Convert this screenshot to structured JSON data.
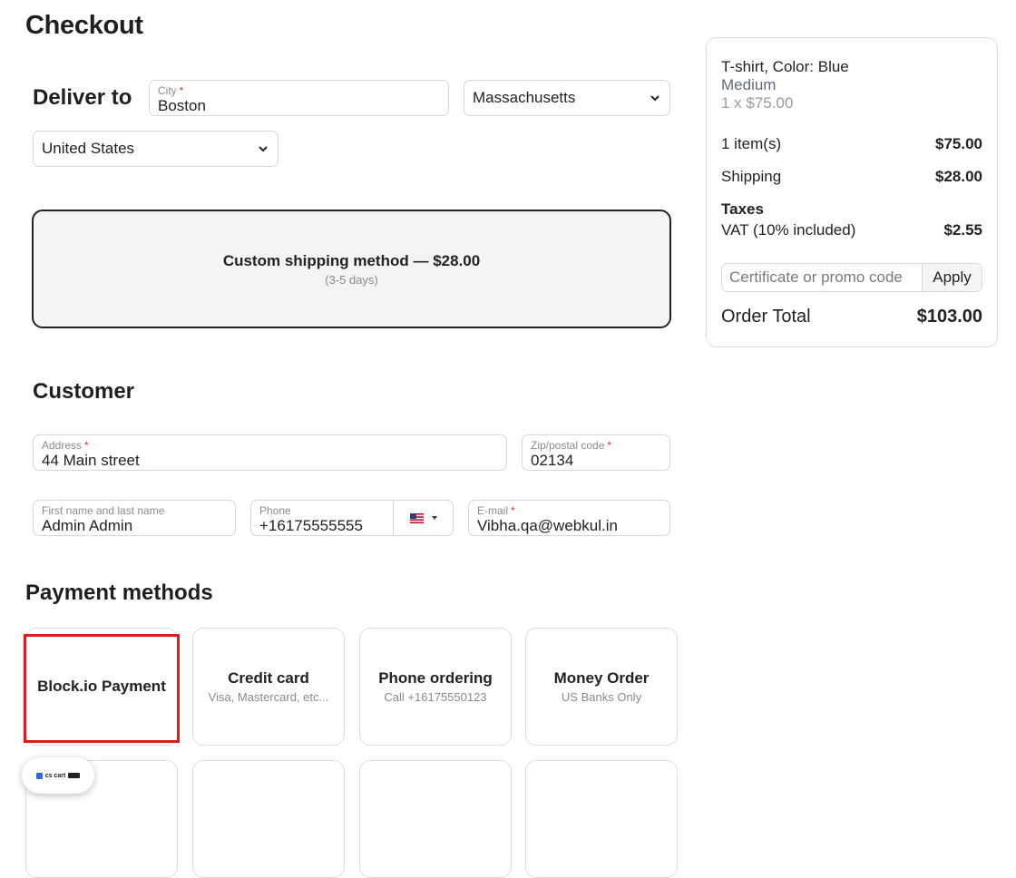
{
  "page": {
    "title": "Checkout"
  },
  "deliver": {
    "heading": "Deliver to",
    "city": {
      "label": "City",
      "required": "*",
      "value": "Boston"
    },
    "state": {
      "value": "Massachusetts"
    },
    "country": {
      "value": "United States"
    }
  },
  "shipping": {
    "title": "Custom shipping method — $28.00",
    "subtitle": "(3-5 days)"
  },
  "customer": {
    "heading": "Customer",
    "address": {
      "label": "Address",
      "required": "*",
      "value": "44 Main street"
    },
    "zip": {
      "label": "Zip/postal code",
      "required": "*",
      "value": "02134"
    },
    "name": {
      "label": "First name and last name",
      "value": "Admin Admin"
    },
    "phone": {
      "label": "Phone",
      "value": "+16175555555"
    },
    "email": {
      "label": "E-mail",
      "required": "*",
      "value": "Vibha.qa@webkul.in"
    }
  },
  "payment": {
    "heading": "Payment methods",
    "methods": [
      {
        "title": "Block.io Payment",
        "subtitle": ""
      },
      {
        "title": "Credit card",
        "subtitle": "Visa, Mastercard, etc..."
      },
      {
        "title": "Phone ordering",
        "subtitle": "Call +16175550123"
      },
      {
        "title": "Money Order",
        "subtitle": "US Banks Only"
      }
    ]
  },
  "summary": {
    "product": {
      "name": "T-shirt, Color: Blue",
      "variant": "Medium",
      "qty_price": "1 x $75.00"
    },
    "items_label": "1 item(s)",
    "items_value": "$75.00",
    "shipping_label": "Shipping",
    "shipping_value": "$28.00",
    "taxes_label": "Taxes",
    "vat_label": "VAT (10% included)",
    "vat_value": "$2.55",
    "promo_placeholder": "Certificate or promo code",
    "apply_label": "Apply",
    "total_label": "Order Total",
    "total_value": "$103.00"
  },
  "badge": {
    "text": "cs cart"
  },
  "colors": {
    "highlight": "#e01b1b",
    "required": "#d9322e",
    "muted": "#8a8a8a"
  }
}
